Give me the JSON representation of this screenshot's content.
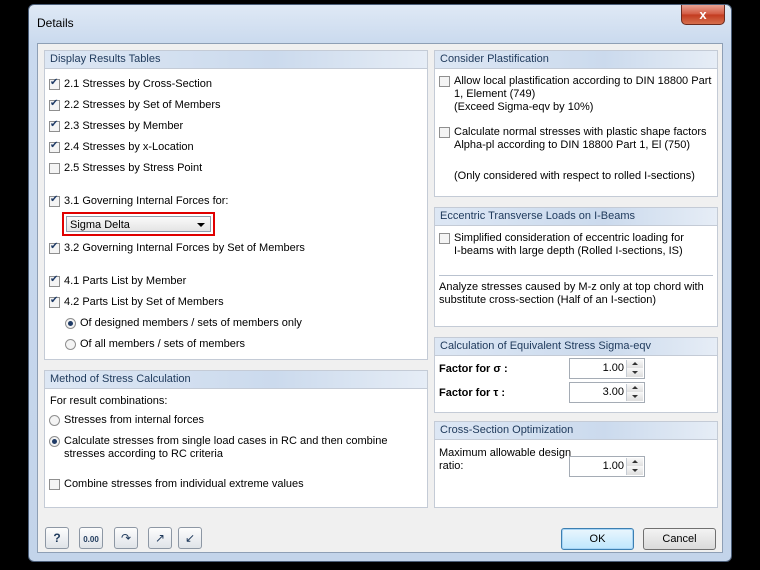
{
  "window": {
    "title": "Details",
    "close_label": "x"
  },
  "display_results": {
    "header": "Display Results Tables",
    "items": [
      {
        "label": "2.1 Stresses by Cross-Section",
        "checked": true
      },
      {
        "label": "2.2 Stresses by Set of Members",
        "checked": true
      },
      {
        "label": "2.3 Stresses by Member",
        "checked": true
      },
      {
        "label": "2.4 Stresses by x-Location",
        "checked": true
      },
      {
        "label": "2.5 Stresses by Stress Point",
        "checked": false
      },
      {
        "label": "3.1 Governing Internal Forces for:",
        "checked": true
      },
      {
        "label": "3.2 Governing Internal Forces by Set of Members",
        "checked": true
      },
      {
        "label": "4.1 Parts List by Member",
        "checked": true
      },
      {
        "label": "4.2 Parts List by Set of Members",
        "checked": true
      }
    ],
    "governing_select": "Sigma Delta",
    "parts_radio": [
      {
        "label": "Of designed members / sets of members only",
        "checked": true
      },
      {
        "label": "Of all members / sets of members",
        "checked": false
      }
    ]
  },
  "method": {
    "header": "Method of Stress Calculation",
    "intro": "For result combinations:",
    "radios": [
      {
        "label": "Stresses from internal forces",
        "checked": false
      },
      {
        "label_line1": "Calculate stresses from single load cases in RC and then combine",
        "label_line2": "stresses according to RC criteria",
        "checked": true
      }
    ],
    "combine": {
      "label": "Combine stresses from individual extreme values",
      "checked": false
    }
  },
  "plastification": {
    "header": "Consider Plastification",
    "opt1": {
      "line1": "Allow local plastification according to DIN 18800 Part",
      "line2": "1, Element (749)",
      "line3": "(Exceed Sigma-eqv by 10%)",
      "checked": false
    },
    "opt2": {
      "line1": "Calculate normal stresses with plastic shape factors",
      "line2": "Alpha-pl according to DIN 18800 Part 1, El (750)",
      "checked": false
    },
    "note": "(Only considered with respect to rolled I-sections)"
  },
  "eccentric": {
    "header": "Eccentric Transverse Loads on I-Beams",
    "opt": {
      "line1": "Simplified consideration of eccentric loading for",
      "line2": "I-beams with large depth (Rolled I-sections, IS)",
      "checked": false
    },
    "note_line1": "Analyze stresses caused by M-z only at top chord with",
    "note_line2": "substitute cross-section (Half of an I-section)"
  },
  "equivalent": {
    "header": "Calculation of Equivalent Stress Sigma-eqv",
    "sigma_label": "Factor for σ :",
    "sigma_value": "1.00",
    "tau_label": "Factor for τ :",
    "tau_value": "3.00"
  },
  "optimization": {
    "header": "Cross-Section Optimization",
    "label_line1": "Maximum allowable design",
    "label_line2": "ratio:",
    "value": "1.00"
  },
  "footer": {
    "tools": [
      {
        "name": "help-icon",
        "glyph": "?"
      },
      {
        "name": "decimal-places-icon",
        "glyph": "0.00"
      },
      {
        "name": "units-icon",
        "glyph": "↷"
      },
      {
        "name": "export-icon",
        "glyph": "↗"
      },
      {
        "name": "import-icon",
        "glyph": "↙"
      }
    ],
    "ok_label": "OK",
    "cancel_label": "Cancel"
  }
}
